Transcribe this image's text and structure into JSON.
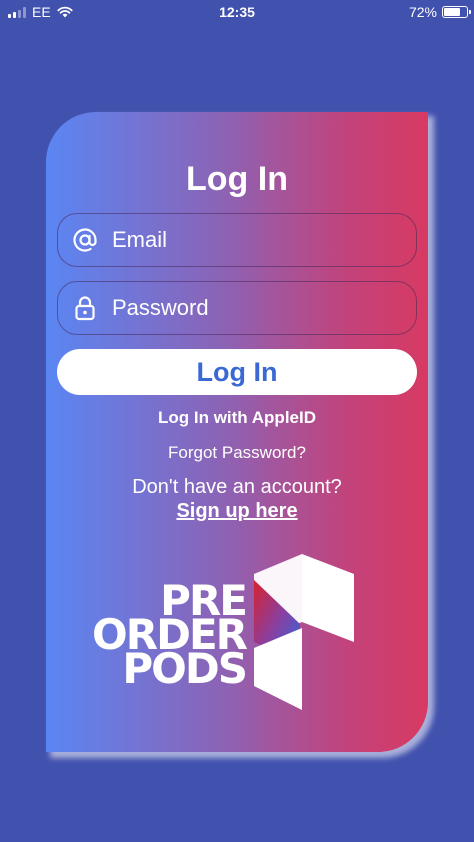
{
  "status_bar": {
    "carrier": "EE",
    "time": "12:35",
    "battery_percent": "72%",
    "battery_level": 0.72
  },
  "login": {
    "title": "Log In",
    "email_placeholder": "Email",
    "password_placeholder": "Password",
    "login_button": "Log In",
    "apple_login": "Log In with AppleID",
    "forgot_password": "Forgot Password?",
    "no_account": "Don't have an account?",
    "signup": "Sign up here"
  },
  "logo": {
    "line1": "PRE",
    "line2": "ORDER",
    "line3": "PODS"
  },
  "colors": {
    "background": "#4151ae",
    "gradient_left": "#5a86f3",
    "gradient_right": "#d73a62",
    "button_text": "#3b69d4"
  },
  "icons": {
    "email": "at-icon",
    "password": "lock-icon"
  }
}
